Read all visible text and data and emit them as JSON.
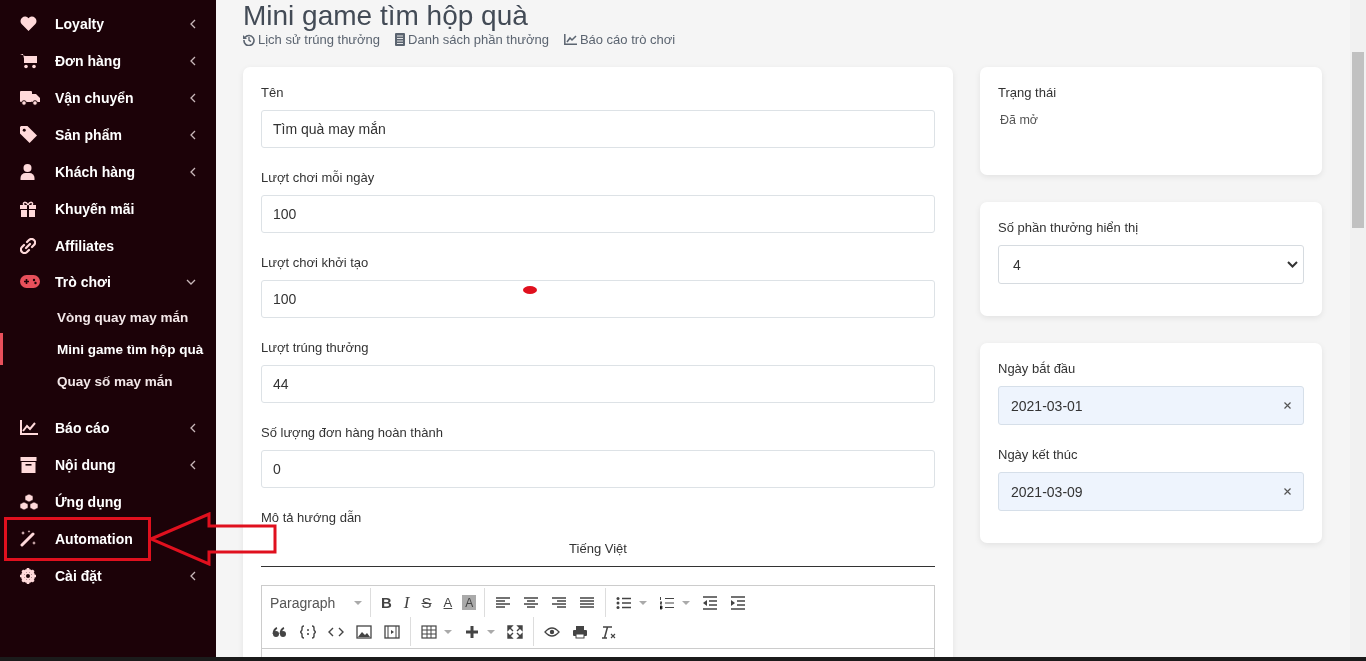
{
  "sidebar": {
    "items": [
      {
        "label": "Loyalty",
        "kind": "group",
        "expanded": false
      },
      {
        "label": "Đơn hàng",
        "kind": "group",
        "expanded": false
      },
      {
        "label": "Vận chuyển",
        "kind": "group",
        "expanded": false
      },
      {
        "label": "Sản phẩm",
        "kind": "group",
        "expanded": false
      },
      {
        "label": "Khách hàng",
        "kind": "group",
        "expanded": false
      },
      {
        "label": "Khuyến mãi",
        "kind": "link"
      },
      {
        "label": "Affiliates",
        "kind": "link"
      },
      {
        "label": "Trò chơi",
        "kind": "group",
        "expanded": true,
        "children": [
          {
            "label": "Vòng quay may mắn",
            "selected": false
          },
          {
            "label": "Mini game tìm hộp quà",
            "selected": true
          },
          {
            "label": "Quay số may mắn",
            "selected": false
          }
        ]
      },
      {
        "label": "Báo cáo",
        "kind": "group",
        "expanded": false
      },
      {
        "label": "Nội dung",
        "kind": "group",
        "expanded": false
      },
      {
        "label": "Ứng dụng",
        "kind": "link"
      },
      {
        "label": "Automation",
        "kind": "link"
      },
      {
        "label": "Cài đặt",
        "kind": "group",
        "expanded": false
      }
    ]
  },
  "page": {
    "title": "Mini game tìm hộp quà",
    "links": [
      "Lịch sử trúng thưởng",
      "Danh sách phần thưởng",
      "Báo cáo trò chơi"
    ]
  },
  "form": {
    "fields": [
      {
        "label": "Tên",
        "value": "Tìm quà may mắn"
      },
      {
        "label": "Lượt chơi mỗi ngày",
        "value": "100"
      },
      {
        "label": "Lượt chơi khởi tạo",
        "value": "100"
      },
      {
        "label": "Lượt trúng thưởng",
        "value": "44"
      },
      {
        "label": "Số lượng đơn hàng hoàn thành",
        "value": "0"
      }
    ],
    "description": {
      "label": "Mô tả hướng dẫn",
      "language_tab": "Tiếng Việt",
      "toolbar": [
        [
          [
            {
              "kind": "select",
              "label": "Paragraph"
            }
          ],
          [
            {
              "kind": "glyph",
              "label": "B"
            },
            {
              "kind": "italic",
              "label": "I"
            },
            {
              "kind": "strike",
              "label": "S"
            },
            {
              "kind": "color",
              "label": "A"
            },
            {
              "kind": "bgcolor",
              "label": "A"
            }
          ],
          [
            {
              "kind": "icon"
            },
            {
              "kind": "icon"
            },
            {
              "kind": "icon"
            },
            {
              "kind": "icon"
            }
          ],
          [
            {
              "kind": "dropicon"
            },
            {
              "kind": "dropicon"
            },
            {
              "kind": "icon"
            },
            {
              "kind": "icon"
            }
          ]
        ],
        [
          [
            {
              "kind": "icon"
            },
            {
              "kind": "icon"
            },
            {
              "kind": "icon"
            },
            {
              "kind": "icon"
            },
            {
              "kind": "icon"
            }
          ],
          [
            {
              "kind": "dropicon"
            },
            {
              "kind": "dropicon"
            },
            {
              "kind": "icon"
            }
          ],
          [
            {
              "kind": "icon"
            },
            {
              "kind": "icon"
            },
            {
              "kind": "icon"
            }
          ]
        ]
      ]
    }
  },
  "status": {
    "label": "Trạng thái",
    "value": "Đã mở"
  },
  "display": {
    "label": "Số phần thưởng hiển thị",
    "value": "4"
  },
  "dates": [
    {
      "label": "Ngày bắt đầu",
      "value": "2021-03-01"
    },
    {
      "label": "Ngày kết thúc",
      "value": "2021-03-09"
    }
  ]
}
